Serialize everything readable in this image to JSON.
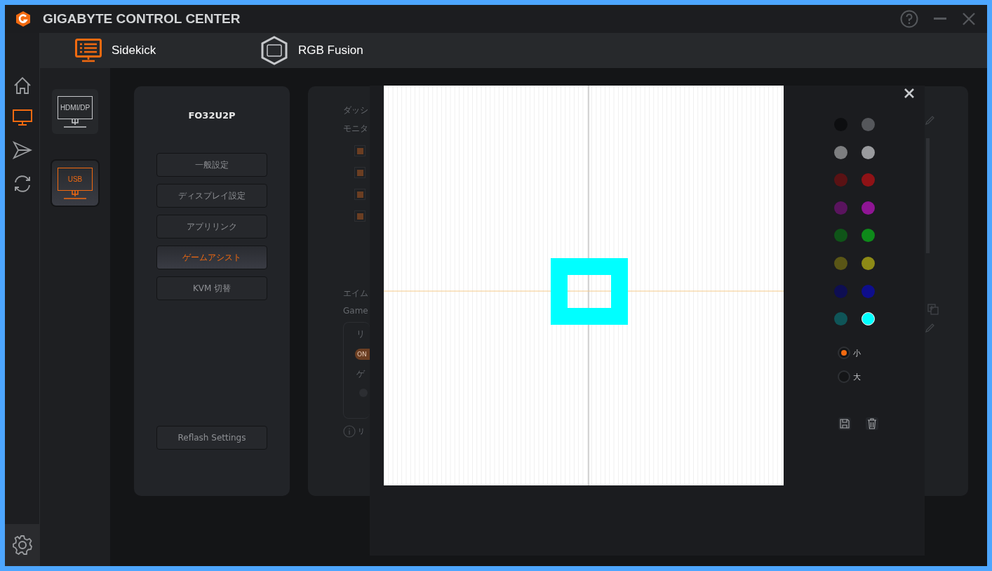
{
  "window": {
    "title": "GIGABYTE CONTROL CENTER"
  },
  "nav_rail": [
    {
      "kind": "home",
      "selected": false
    },
    {
      "kind": "monitor",
      "selected": true
    },
    {
      "kind": "send",
      "selected": false
    },
    {
      "kind": "sync",
      "selected": false
    }
  ],
  "top_tabs": [
    {
      "kind": "sidekick",
      "label": "Sidekick",
      "selected": true
    },
    {
      "kind": "rgb",
      "label": "RGB Fusion",
      "selected": false
    }
  ],
  "monitor_inputs": [
    {
      "label": "HDMI/DP",
      "selected": false
    },
    {
      "label": "USB",
      "selected": true
    }
  ],
  "device_panel": {
    "title": "FO32U2P",
    "menu": [
      {
        "label": "一般設定",
        "selected": false
      },
      {
        "label": "ディスプレイ設定",
        "selected": false
      },
      {
        "label": "アプリリンク",
        "selected": false
      },
      {
        "label": "ゲームアシスト",
        "selected": true
      },
      {
        "label": "KVM 切替",
        "selected": false
      }
    ],
    "reflash_button": "Reflash Settings"
  },
  "background_panel": {
    "section_1": {
      "title": "ダッシ",
      "subtitle": "モニタ",
      "checkboxes": [
        {
          "checked": true
        },
        {
          "checked": true
        },
        {
          "checked": true
        },
        {
          "checked": true
        }
      ]
    },
    "section_2": {
      "title": "エイム",
      "subtitle": "Game",
      "box_label": "リ",
      "toggle": {
        "label": "ON",
        "on": true
      },
      "box_label_2": "ゲ",
      "radio": {
        "selected": false
      },
      "note": "リ"
    }
  },
  "crosshair_editor": {
    "swatches": [
      {
        "color": "#0d0e10",
        "selected": false
      },
      {
        "color": "#55575b",
        "selected": false
      },
      {
        "color": "#7d7e80",
        "selected": false
      },
      {
        "color": "#9a9b9e",
        "selected": false
      },
      {
        "color": "#5a1214",
        "selected": false
      },
      {
        "color": "#8f1216",
        "selected": false
      },
      {
        "color": "#5a145e",
        "selected": false
      },
      {
        "color": "#8f1594",
        "selected": false
      },
      {
        "color": "#0f5418",
        "selected": false
      },
      {
        "color": "#0e8a1a",
        "selected": false
      },
      {
        "color": "#5a5616",
        "selected": false
      },
      {
        "color": "#8d8a16",
        "selected": false
      },
      {
        "color": "#0e0e52",
        "selected": false
      },
      {
        "color": "#0e0e8c",
        "selected": false
      },
      {
        "color": "#0f5558",
        "selected": false
      },
      {
        "color": "#00ffff",
        "selected": true
      }
    ],
    "sizes": [
      {
        "label": "小",
        "selected": true
      },
      {
        "label": "大",
        "selected": false
      }
    ]
  }
}
